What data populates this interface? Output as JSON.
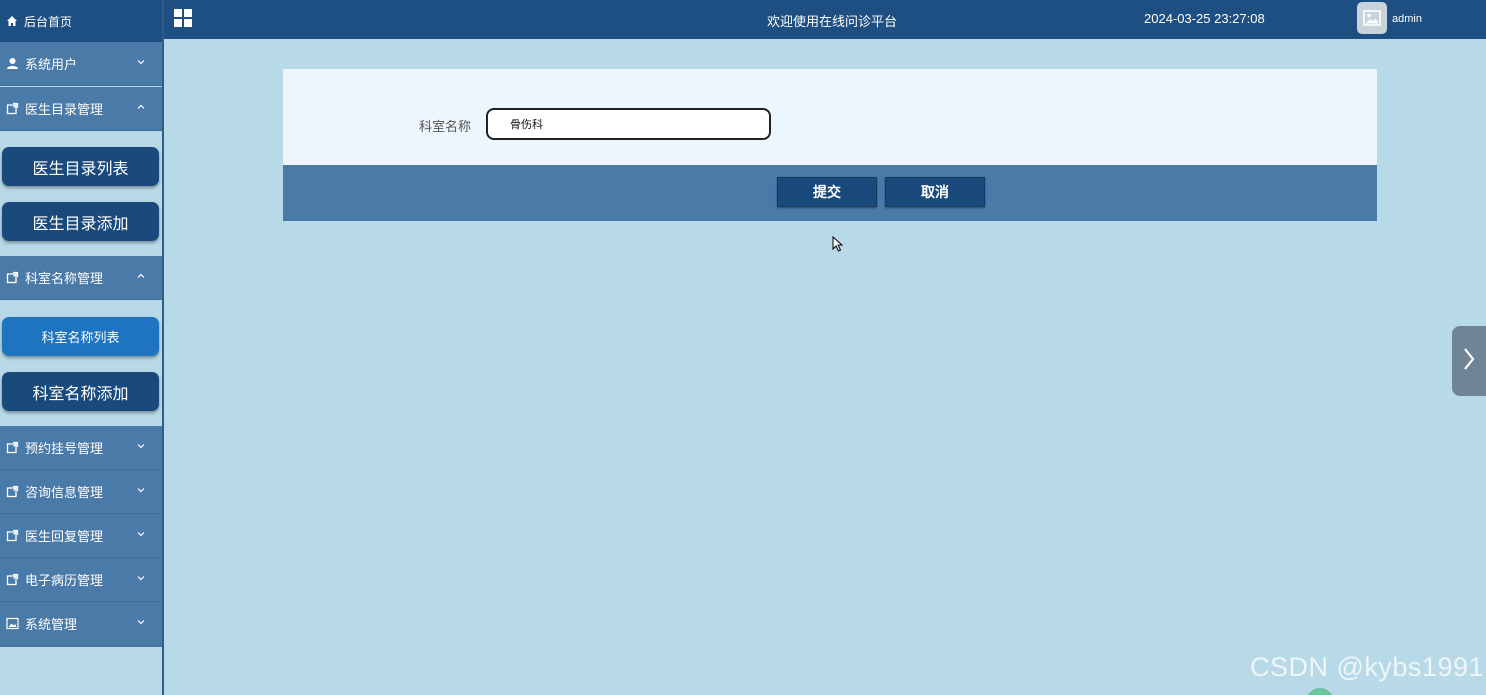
{
  "sidebar": {
    "home_label": "后台首页",
    "groups": [
      {
        "label": "系统用户",
        "icon": "user-icon",
        "expanded": false
      },
      {
        "label": "医生目录管理",
        "icon": "external-icon",
        "expanded": true
      },
      {
        "label": "科室名称管理",
        "icon": "external-icon",
        "expanded": true
      },
      {
        "label": "预约挂号管理",
        "icon": "external-icon",
        "expanded": false
      },
      {
        "label": "咨询信息管理",
        "icon": "external-icon",
        "expanded": false
      },
      {
        "label": "医生回复管理",
        "icon": "external-icon",
        "expanded": false
      },
      {
        "label": "电子病历管理",
        "icon": "external-icon",
        "expanded": false
      },
      {
        "label": "系统管理",
        "icon": "image-icon",
        "expanded": false
      }
    ],
    "doctor_sub": [
      "医生目录列表",
      "医生目录添加"
    ],
    "dept_sub": [
      "科室名称列表",
      "科室名称添加"
    ]
  },
  "header": {
    "welcome": "欢迎使用在线问诊平台",
    "datetime": "2024-03-25 23:27:08",
    "username": "admin"
  },
  "form": {
    "field_label": "科室名称",
    "field_value": "骨伤科",
    "submit_label": "提交",
    "cancel_label": "取消"
  },
  "watermark": "CSDN @kybs1991",
  "colors": {
    "header_bg": "#1e4f82",
    "menu_bg": "#4a7aa8",
    "page_bg": "#b8d9e8",
    "active_sub": "#1e74c0",
    "button_bg": "#1a4a7c"
  }
}
